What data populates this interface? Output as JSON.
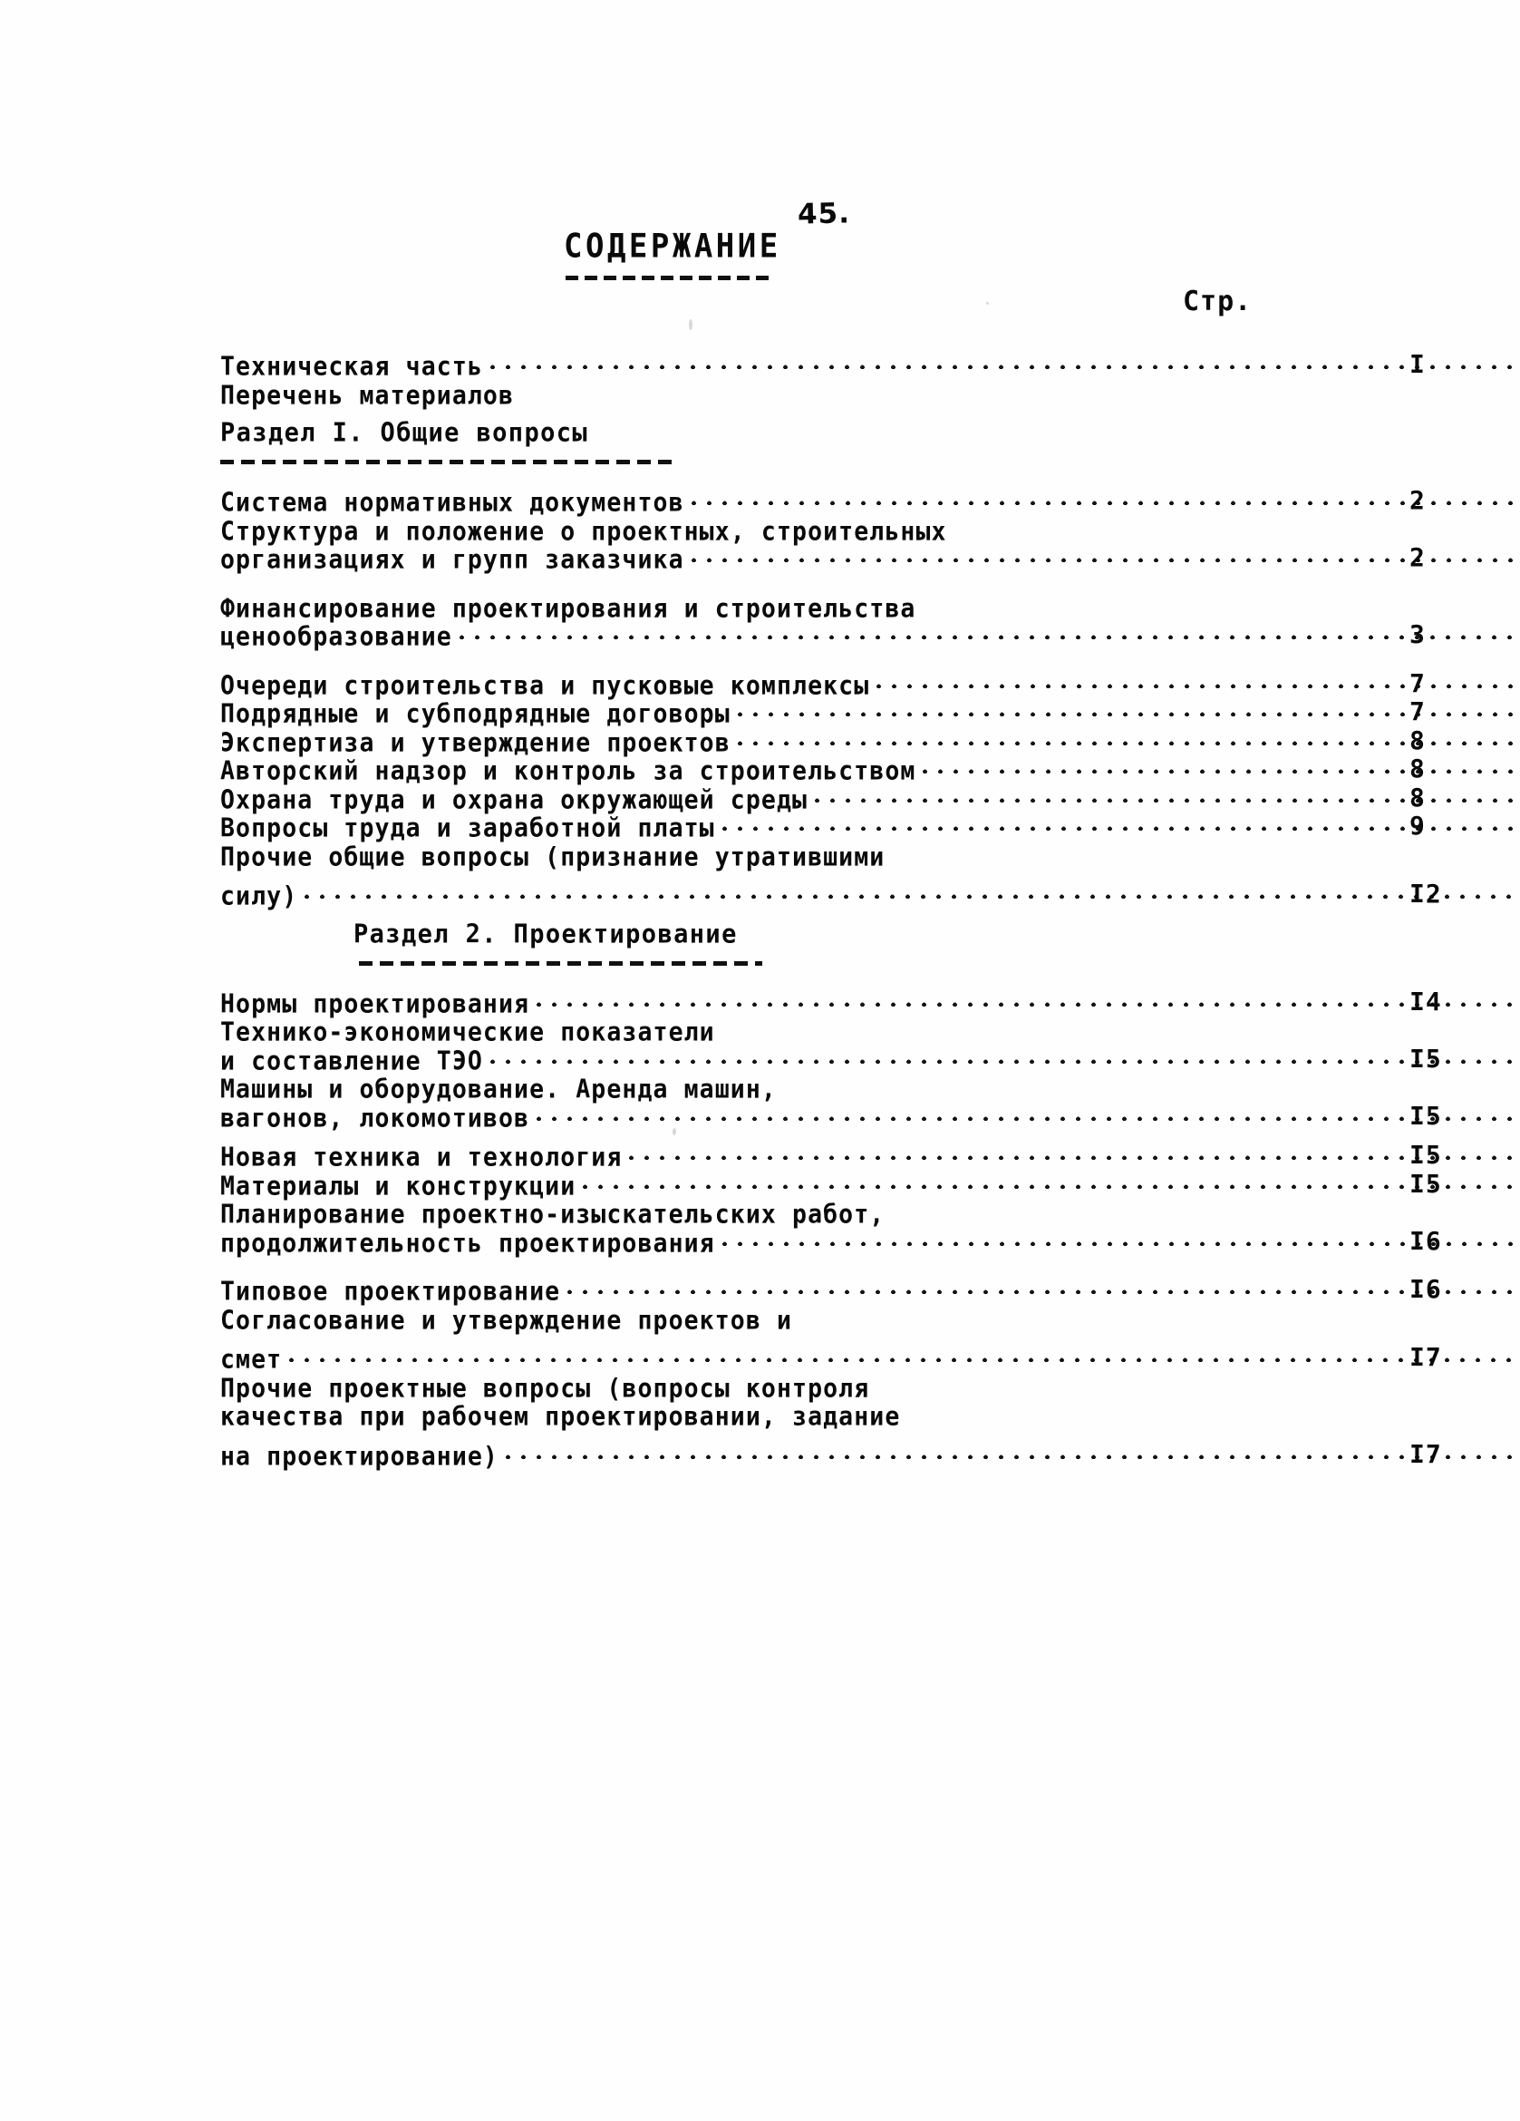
{
  "document": {
    "folio": "45.",
    "title": "СОДЕРЖАНИЕ",
    "page_column_header": "Стр."
  },
  "toc": {
    "intro": [
      {
        "text": "Техническая часть",
        "page": "I",
        "leader": true
      },
      {
        "text": "Перечень материалов",
        "page": "",
        "leader": false
      }
    ],
    "sections": [
      {
        "heading": "Раздел I. Общие вопросы",
        "entries": [
          {
            "lines": [
              "Система нормативных документов"
            ],
            "page": "2"
          },
          {
            "lines": [
              "Структура и положение о проектных, строительных",
              "организациях и групп заказчика"
            ],
            "page": "2"
          },
          {
            "lines": [
              "Финансирование проектирования и строительства",
              "ценообразование"
            ],
            "page": "3"
          },
          {
            "lines": [
              "Очереди строительства и пусковые комплексы"
            ],
            "page": "7"
          },
          {
            "lines": [
              "Подрядные и субподрядные договоры"
            ],
            "page": "7"
          },
          {
            "lines": [
              "Экспертиза и утверждение проектов"
            ],
            "page": "8"
          },
          {
            "lines": [
              "Авторский надзор и контроль за строительством"
            ],
            "page": "8"
          },
          {
            "lines": [
              "Охрана труда и охрана окружающей среды"
            ],
            "page": "8"
          },
          {
            "lines": [
              "Вопросы труда и заработной платы"
            ],
            "page": "9"
          },
          {
            "lines": [
              "Прочие общие вопросы (признание утратившими",
              "силу)"
            ],
            "page": "I2"
          }
        ]
      },
      {
        "heading": "Раздел 2. Проектирование",
        "entries": [
          {
            "lines": [
              "Нормы проектирования"
            ],
            "page": "I4"
          },
          {
            "lines": [
              "Технико-экономические показатели",
              "и составление ТЭО"
            ],
            "page": "I5"
          },
          {
            "lines": [
              "Машины и оборудование. Аренда машин,",
              "вагонов, локомотивов"
            ],
            "page": "I5"
          },
          {
            "lines": [
              "Новая техника и технология"
            ],
            "page": "I5"
          },
          {
            "lines": [
              "Материалы и конструкции"
            ],
            "page": "I5"
          },
          {
            "lines": [
              "Планирование проектно-изыскательских работ,",
              "продолжительность проектирования"
            ],
            "page": "I6"
          },
          {
            "lines": [
              "Типовое проектирование"
            ],
            "page": "I6"
          },
          {
            "lines": [
              "Согласование и утверждение проектов и",
              "смет"
            ],
            "page": "I7"
          },
          {
            "lines": [
              "Прочие проектные вопросы (вопросы контроля",
              "качества при рабочем проектировании, задание",
              "на проектирование)"
            ],
            "page": "I7"
          }
        ]
      }
    ]
  }
}
